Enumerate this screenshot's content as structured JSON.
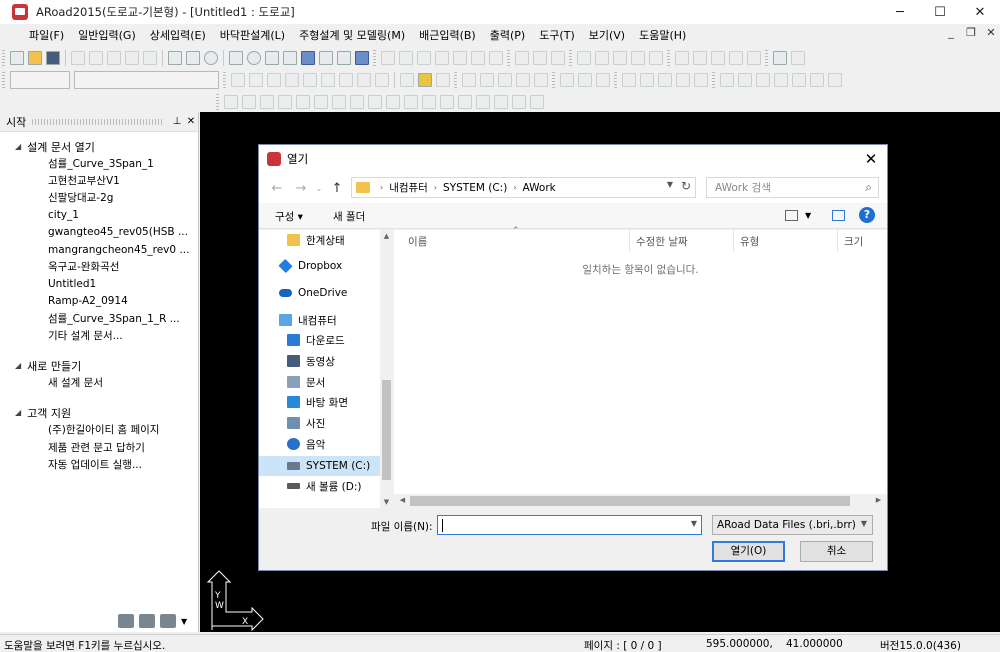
{
  "window": {
    "title": "ARoad2015(도로교-기본형) - [Untitled1 : 도로교]",
    "minimize": "─",
    "maximize": "☐",
    "close": "✕"
  },
  "menu": [
    "파일(F)",
    "일반입력(G)",
    "상세입력(E)",
    "바닥판설계(L)",
    "주형설계 및 모델링(M)",
    "배근입력(B)",
    "출력(P)",
    "도구(T)",
    "보기(V)",
    "도움말(H)"
  ],
  "mdi": {
    "minimize": "_",
    "restore": "❐",
    "close": "✕"
  },
  "start_panel": {
    "title": "시작",
    "pin": "📌",
    "close": "✕",
    "sections": [
      {
        "heading": "설계 문서 열기",
        "links": [
          "섬률_Curve_3Span_1",
          "고현천교부산V1",
          "신팔당대교-2g",
          "city_1",
          "gwangteo45_rev05(HSB ...",
          "mangrangcheon45_rev0 ...",
          "옥구교-완화곡선",
          "Untitled1",
          "Ramp-A2_0914",
          "섬률_Curve_3Span_1_R ...",
          "기타 설계 문서..."
        ]
      },
      {
        "heading": "새로 만들기",
        "links": [
          "새 설계 문서"
        ]
      },
      {
        "heading": "고객 지원",
        "links": [
          "(주)한길아이티 홈 페이지",
          "제품 관련 문고 답하기",
          "자동 업데이트 실행..."
        ]
      }
    ]
  },
  "statusbar": {
    "help": "도움말을 보려면 F1키를 누르십시오.",
    "page": "페이지 : [ 0 / 0 ]",
    "x": "595.000000,",
    "y": "41.000000",
    "version": "버전15.0.0(436)"
  },
  "dialog": {
    "title": "열기",
    "close": "✕",
    "breadcrumb": [
      "내컴퓨터",
      "SYSTEM (C:)",
      "AWork"
    ],
    "search_placeholder": "AWork 검색",
    "organize": "구성 ▾",
    "new_folder": "새 폴더",
    "nav_items": [
      {
        "label": "한계상태",
        "icon": "folder-icon",
        "color": "#f2c14e"
      },
      {
        "label": "Dropbox",
        "icon": "dropbox-icon",
        "color": "#1e7fe0"
      },
      {
        "label": "OneDrive",
        "icon": "onedrive-icon",
        "color": "#1565c0"
      },
      {
        "label": "내컴퓨터",
        "icon": "computer-icon",
        "color": "#5ba4e6"
      },
      {
        "label": "다운로드",
        "icon": "download-icon",
        "color": "#2a7bd4"
      },
      {
        "label": "동영상",
        "icon": "video-icon",
        "color": "#4a5a7a"
      },
      {
        "label": "문서",
        "icon": "document-icon",
        "color": "#8aa0b8"
      },
      {
        "label": "바탕 화면",
        "icon": "desktop-icon",
        "color": "#2a88d8"
      },
      {
        "label": "사진",
        "icon": "picture-icon",
        "color": "#6e8fb0"
      },
      {
        "label": "음악",
        "icon": "music-icon",
        "color": "#2a6fc8"
      },
      {
        "label": "SYSTEM (C:)",
        "icon": "drive-c-icon",
        "color": "#6a7a8a"
      },
      {
        "label": "새 볼륨 (D:)",
        "icon": "drive-d-icon",
        "color": "#5a5a5a"
      }
    ],
    "columns": [
      "이름",
      "수정한 날짜",
      "유형",
      "크기"
    ],
    "empty_message": "일치하는 항목이 없습니다.",
    "filename_label": "파일 이름(N):",
    "filename_value": "",
    "filetype": "ARoad Data Files (.bri,.brr)",
    "open_button": "열기(O)",
    "cancel_button": "취소"
  },
  "colors": {
    "accent": "#2f7bd9",
    "selection": "#cce4f7",
    "canvas": "#000000"
  }
}
